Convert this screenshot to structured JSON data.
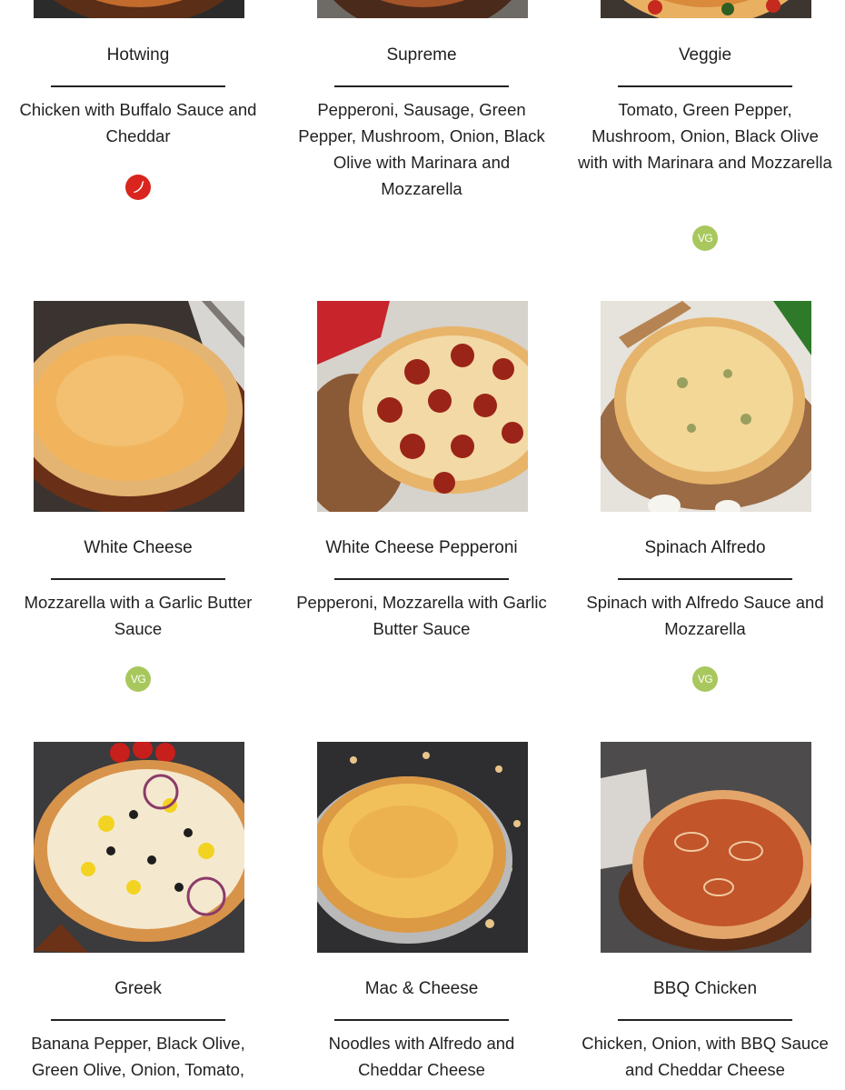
{
  "menu": [
    {
      "name": "Hotwing",
      "desc": "Chicken with Buffalo Sauce and Cheddar",
      "badge": "chili-pepper-icon"
    },
    {
      "name": "Supreme",
      "desc": "Pepperoni, Sausage, Green Pepper, Mushroom, Onion, Black Olive with Marinara and Mozzarella",
      "badge": ""
    },
    {
      "name": "Veggie",
      "desc": "Tomato, Green Pepper, Mushroom, Onion, Black Olive with with Marinara and Mozzarella",
      "badge": "VG"
    },
    {
      "name": "White Cheese",
      "desc": "Mozzarella with a Garlic Butter Sauce",
      "badge": "VG"
    },
    {
      "name": "White Cheese Pepperoni",
      "desc": "Pepperoni, Mozzarella with Garlic Butter Sauce",
      "badge": ""
    },
    {
      "name": "Spinach Alfredo",
      "desc": "Spinach with Alfredo Sauce and Mozzarella",
      "badge": "VG"
    },
    {
      "name": "Greek",
      "desc": "Banana Pepper, Black Olive, Green Olive, Onion, Tomato,",
      "badge": ""
    },
    {
      "name": "Mac & Cheese",
      "desc": "Noodles with Alfredo and Cheddar Cheese",
      "badge": ""
    },
    {
      "name": "BBQ Chicken",
      "desc": "Chicken, Onion, with BBQ Sauce and Cheddar Cheese",
      "badge": ""
    }
  ],
  "colors": {
    "spicy_badge": "#d9251d",
    "veg_badge": "#a8c85e"
  }
}
